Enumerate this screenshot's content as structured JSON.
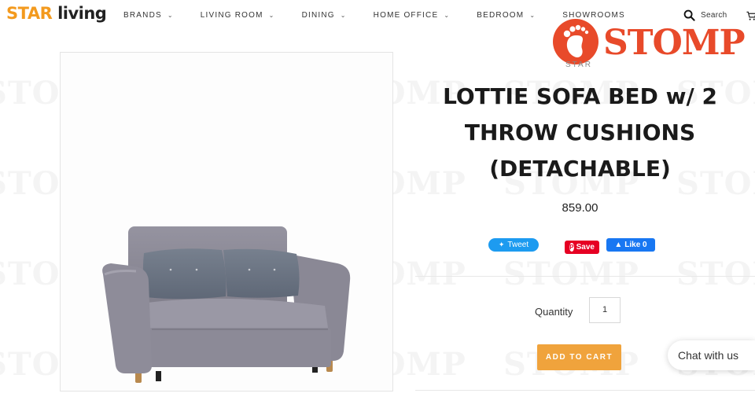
{
  "header": {
    "logo_part1": "STAR",
    "logo_part2": "living",
    "nav": [
      "BRANDS",
      "LIVING ROOM",
      "DINING",
      "HOME OFFICE",
      "BEDROOM",
      "SHOWROOMS"
    ],
    "search_label": "Search"
  },
  "stomp": {
    "brand": "STOMP",
    "sub": "STAR"
  },
  "product": {
    "title_lines": [
      "LOTTIE SOFA BED w/ 2",
      "THROW CUSHIONS",
      "(DETACHABLE)"
    ],
    "price": "859.00"
  },
  "social": {
    "tweet": "Tweet",
    "save": "Save",
    "like": "Like 0"
  },
  "quantity": {
    "label": "Quantity",
    "value": "1"
  },
  "add_to_cart": "ADD TO CART",
  "chat": "Chat with us",
  "watermark": "STOMP",
  "colors": {
    "brand_orange": "#f39a1e",
    "stomp_red": "#e84a2a",
    "cart_button": "#f0a33c",
    "sofa": "#8b8995",
    "cushion": "#6e7785"
  }
}
